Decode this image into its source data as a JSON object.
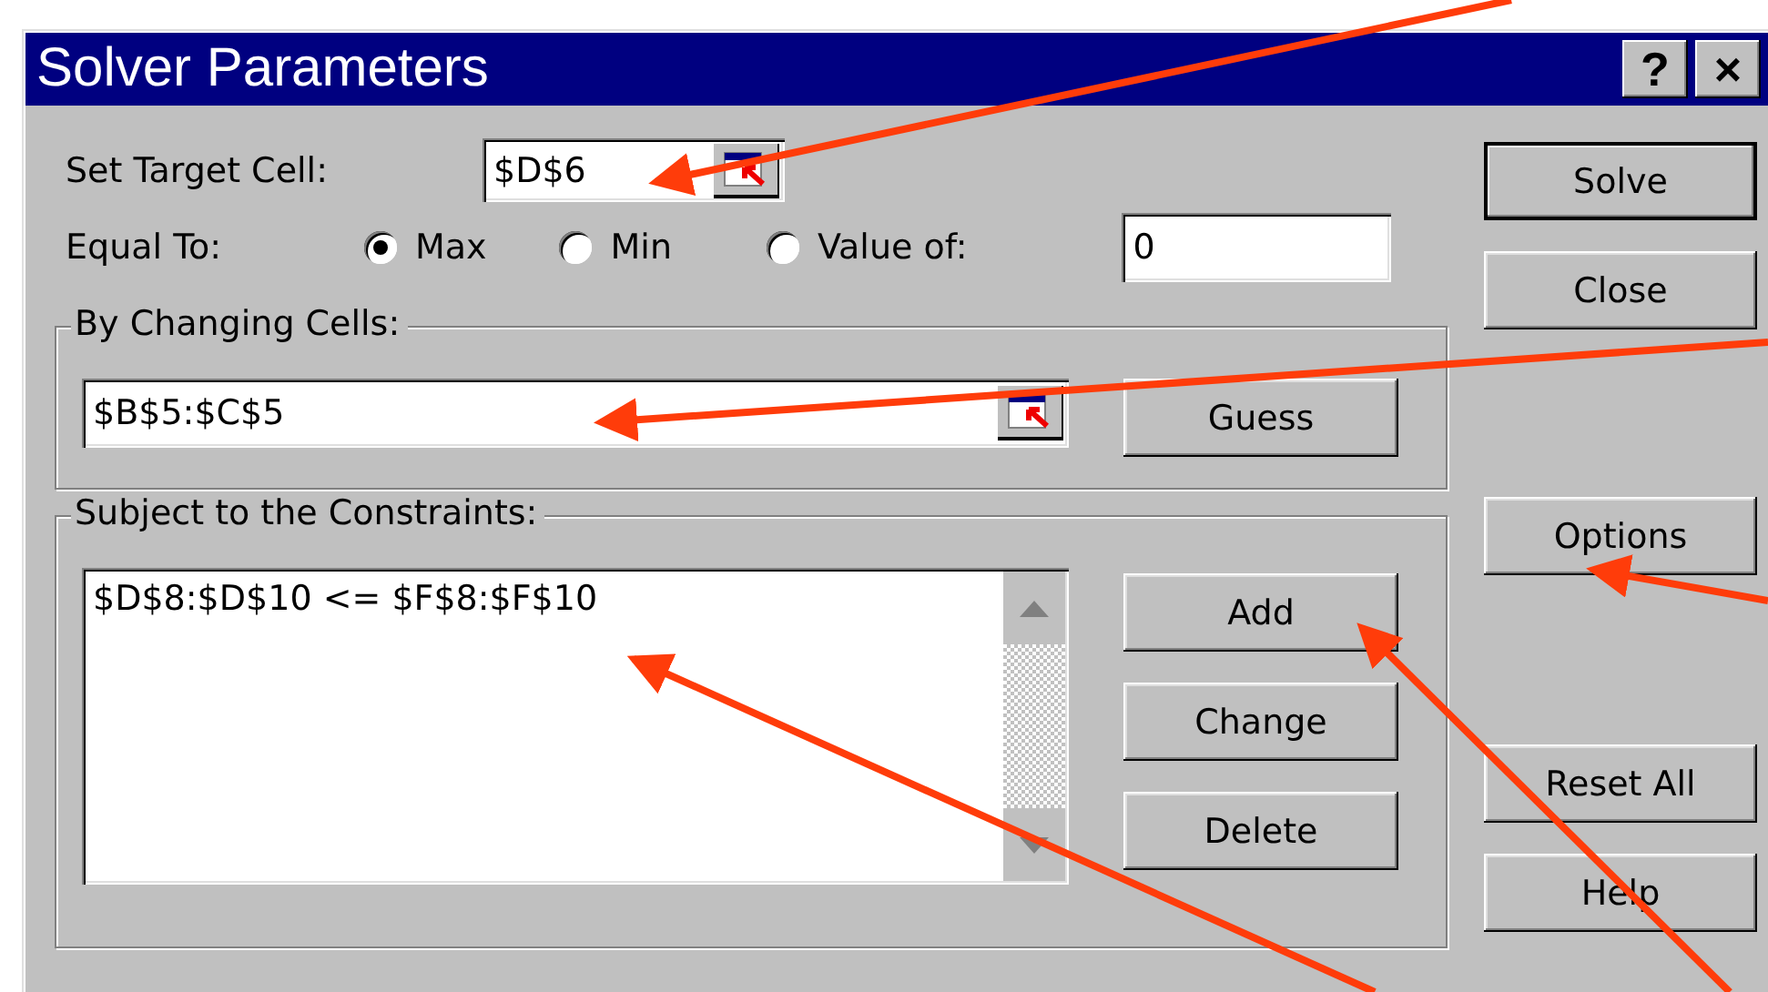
{
  "window": {
    "title": "Solver Parameters",
    "title_buttons": [
      "?",
      "×"
    ]
  },
  "target_cell": {
    "label": "Set Target Cell:",
    "value": "$D$6"
  },
  "equal_to": {
    "label": "Equal To:",
    "options": [
      {
        "label": "Max",
        "selected": true
      },
      {
        "label": "Min",
        "selected": false
      },
      {
        "label": "Value of:",
        "selected": false
      }
    ],
    "value": "0"
  },
  "changing_cells": {
    "label": "By Changing Cells:",
    "value": "$B$5:$C$5",
    "button": "Guess"
  },
  "constraints": {
    "label": "Subject to the Constraints:",
    "items": [
      "$D$8:$D$10 <= $F$8:$F$10"
    ],
    "buttons": [
      "Add",
      "Change",
      "Delete"
    ]
  },
  "side_buttons": [
    {
      "label": "Solve",
      "default": true
    },
    {
      "label": "Close",
      "default": false
    },
    {
      "label": "Options",
      "default": false
    },
    {
      "label": "Reset All",
      "default": false
    },
    {
      "label": "Help",
      "default": false
    }
  ]
}
